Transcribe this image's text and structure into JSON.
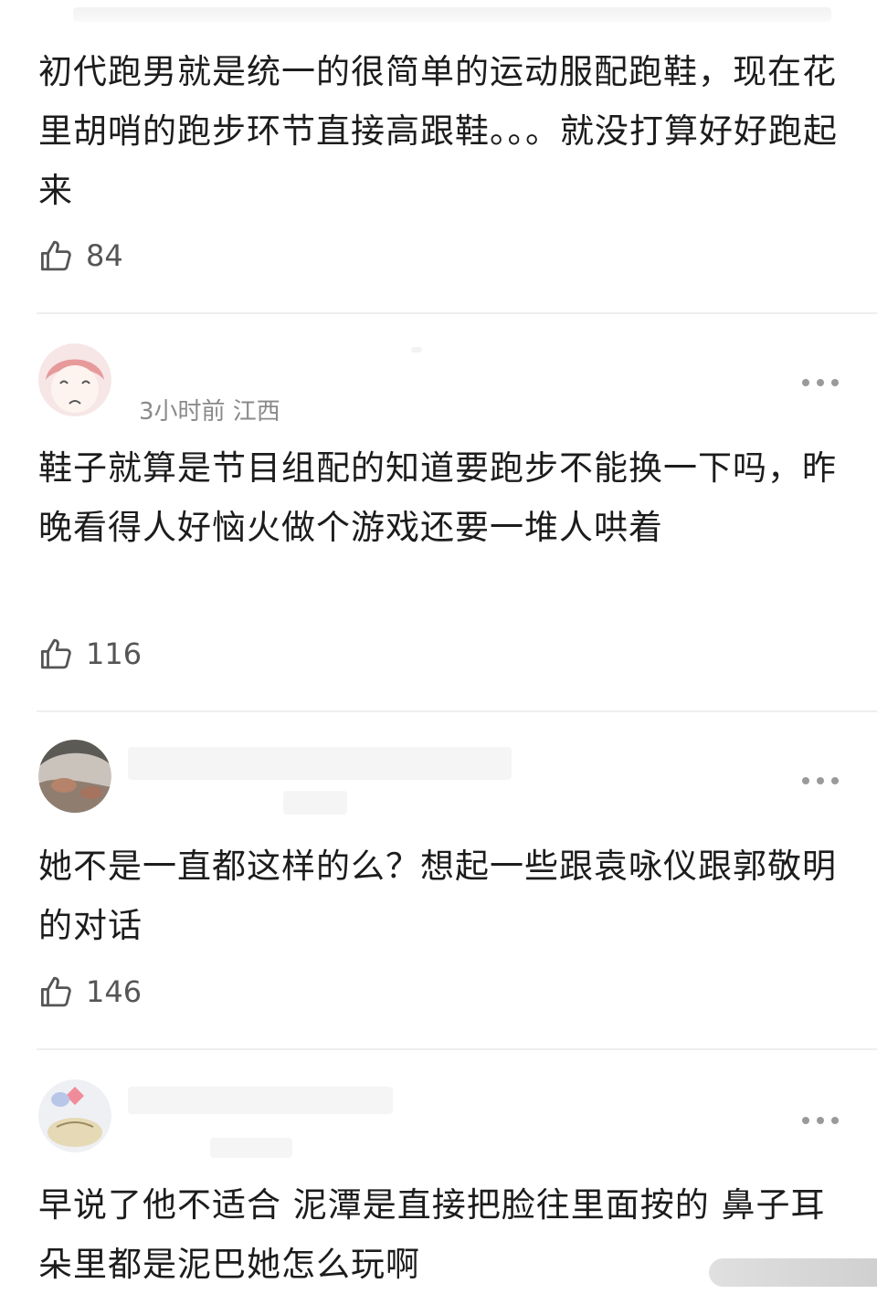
{
  "comments": [
    {
      "text": "初代跑男就是统一的很简单的运动服配跑鞋，现在花里胡哨的跑步环节直接高跟鞋。。。就没打算好好跑起来",
      "likes": "84"
    },
    {
      "meta": "3小时前 江西",
      "text": "鞋子就算是节目组配的知道要跑步不能换一下吗，昨晚看得人好恼火做个游戏还要一堆人哄着",
      "likes": "116"
    },
    {
      "text": "她不是一直都这样的么？想起一些跟袁咏仪跟郭敬明的对话",
      "likes": "146"
    },
    {
      "text": "早说了他不适合 泥潭是直接把脸往里面按的 鼻子耳朵里都是泥巴她怎么玩啊"
    }
  ],
  "icons": {
    "like": "thumbs-up-icon",
    "more": "more-dots-icon"
  }
}
